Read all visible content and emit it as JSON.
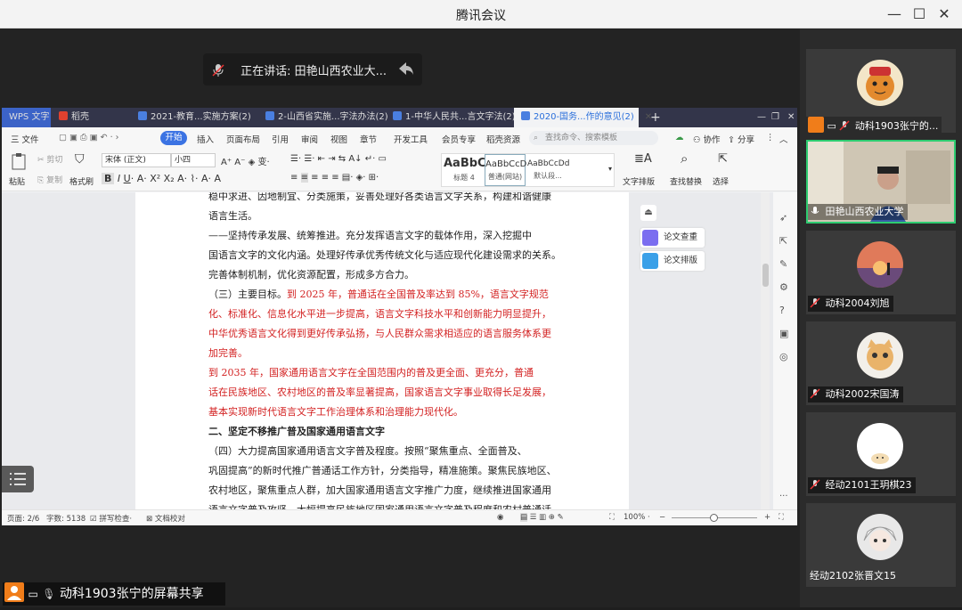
{
  "app": {
    "title": "腾讯会议",
    "window_controls": [
      "minimize-icon",
      "maximize-icon",
      "close-icon"
    ]
  },
  "speaking": {
    "label": "正在讲话: 田艳山西农业大..."
  },
  "share_label": {
    "text": "动科1903张宁的屏幕共享"
  },
  "wps": {
    "tabs": [
      {
        "label": "WPS 文字"
      },
      {
        "label": "稻壳"
      },
      {
        "label": "2021-教育...实施方案(2)"
      },
      {
        "label": "2-山西省实施...字法办法(2)"
      },
      {
        "label": "1-中华人民共...言文字法(2)"
      },
      {
        "label": "2020-国务...作的意见(2)"
      }
    ],
    "menu": {
      "file": "三 文件",
      "start": "开始",
      "items": [
        "插入",
        "页面布局",
        "引用",
        "审阅",
        "视图",
        "章节",
        "开发工具",
        "会员专享",
        "稻壳资源"
      ],
      "search_placeholder": "查找命令、搜索模板",
      "collab": "协作",
      "share": "分享"
    },
    "ribbon": {
      "paste": "粘贴",
      "cut": "剪切",
      "copy": "复制",
      "format_painter": "格式刷",
      "font": "宋体 (正文)",
      "size": "小四",
      "styles": [
        {
          "preview": "AaBbC",
          "name": "标题 4"
        },
        {
          "preview": "AaBbCcD",
          "name": "普通(网站)"
        },
        {
          "preview": "AaBbCcDd",
          "name": "默认段..."
        }
      ],
      "text_layout": "文字排版",
      "find_replace": "查找替换",
      "select": "选择"
    },
    "side_buttons": [
      "论文查重",
      "论文排版"
    ],
    "document": {
      "lines": [
        {
          "text": "稳中求进、因地制宜、分类施策，妥善处理好各类语言文字关系，构建和谐健康",
          "style": "normal"
        },
        {
          "text": "语言生活。",
          "style": "normal"
        },
        {
          "text": "    ——坚持传承发展、统筹推进。充分发挥语言文字的载体作用，深入挖掘中",
          "style": "normal"
        },
        {
          "text": "国语言文字的文化内涵。处理好传承优秀传统文化与适应现代化建设需求的关系。",
          "style": "normal"
        },
        {
          "text": "完善体制机制，优化资源配置，形成多方合力。",
          "style": "normal"
        },
        {
          "text": "    （三）主要目标。到 2025 年，普通话在全国普及率达到 85%，语言文字规范",
          "style": "mixed"
        },
        {
          "text": "化、标准化、信息化水平进一步提高，语言文字科技水平和创新能力明显提升，",
          "style": "red"
        },
        {
          "text": "中华优秀语言文化得到更好传承弘扬，与人民群众需求相适应的语言服务体系更",
          "style": "red"
        },
        {
          "text": "加完善。",
          "style": "red"
        },
        {
          "text": "    到 2035 年，国家通用语言文字在全国范围内的普及更全面、更充分，普通",
          "style": "red"
        },
        {
          "text": "话在民族地区、农村地区的普及率显著提高，国家语言文字事业取得长足发展，",
          "style": "red"
        },
        {
          "text": "基本实现新时代语言文字工作治理体系和治理能力现代化。",
          "style": "red"
        },
        {
          "text": "    二、坚定不移推广普及国家通用语言文字",
          "style": "bold"
        },
        {
          "text": "    （四）大力提高国家通用语言文字普及程度。按照“聚焦重点、全面普及、",
          "style": "normal"
        },
        {
          "text": "巩固提高”的新时代推广普通话工作方针，分类指导，精准施策。聚焦民族地区、",
          "style": "normal"
        },
        {
          "text": "农村地区，聚焦重点人群，加大国家通用语言文字推广力度，继续推进国家通用",
          "style": "normal"
        },
        {
          "text": "语言文字普及攻坚，大幅提高民族地区国家通用语言文字普及程度和农村普通话",
          "style": "normal"
        }
      ],
      "mixed_prefix": "    （三）主要目标，"
    },
    "status": {
      "page": "页面: 2/6",
      "words": "字数: 5138",
      "spell": "拼写检查",
      "proof": "文档校对",
      "zoom": "100%"
    }
  },
  "participants": [
    {
      "name": "动科1903张宁的...",
      "avatar": "tiger",
      "active": false,
      "sharing": true
    },
    {
      "name": "田艳山西农业大学",
      "avatar": "video",
      "active": true,
      "sharing": false
    },
    {
      "name": "动科2004刘旭",
      "avatar": "sunset",
      "active": false,
      "sharing": false
    },
    {
      "name": "动科2002宋国涛",
      "avatar": "cat",
      "active": false,
      "sharing": false
    },
    {
      "name": "经动2101王玥棋23",
      "avatar": "cartoon",
      "active": false,
      "sharing": false
    },
    {
      "name": "经动2102张晋文15",
      "avatar": "anime",
      "active": false,
      "sharing": false
    }
  ],
  "colors": {
    "active_border": "#2ecc71",
    "accent_orange": "#f07d1a",
    "wps_blue": "#3b73e3",
    "doc_red": "#d32222"
  }
}
